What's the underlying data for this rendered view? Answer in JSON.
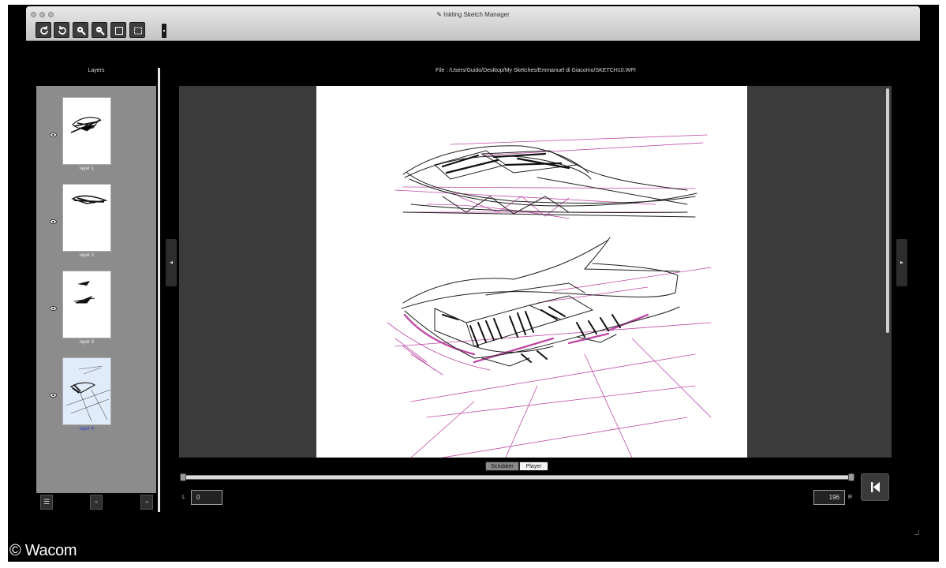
{
  "window": {
    "title": "Inkling Sketch Manager"
  },
  "toolbar": {
    "buttons": [
      {
        "name": "rotate-clockwise",
        "icon": "rotate-cw-icon"
      },
      {
        "name": "rotate-counterclockwise",
        "icon": "rotate-ccw-icon"
      },
      {
        "name": "zoom-in",
        "icon": "zoom-in-icon"
      },
      {
        "name": "zoom-out",
        "icon": "zoom-out-icon"
      },
      {
        "name": "fit-page",
        "icon": "fit-page-icon"
      },
      {
        "name": "crop",
        "icon": "crop-icon"
      }
    ]
  },
  "layers": {
    "title": "Layers",
    "items": [
      {
        "label": "layer 1",
        "selected": false
      },
      {
        "label": "layer 2",
        "selected": false
      },
      {
        "label": "layer 3",
        "selected": false
      },
      {
        "label": "layer 4",
        "selected": true
      }
    ]
  },
  "file": {
    "path": "File : /Users/Guido/Desktop/My Sketches/Emmanuel di Giacomo/SKETCH10.WPI"
  },
  "playback": {
    "mode_scrubber": "Scrubber",
    "mode_player": "Player",
    "active_mode": "Scrubber",
    "left_label": "L",
    "right_label": "R",
    "left_value": "0",
    "right_value": "196"
  },
  "colors": {
    "ink": "#222222",
    "accent_magenta": "#b5359a",
    "selected_layer_text": "#2c3fd0"
  },
  "footer": {
    "copyright": "© Wacom"
  }
}
